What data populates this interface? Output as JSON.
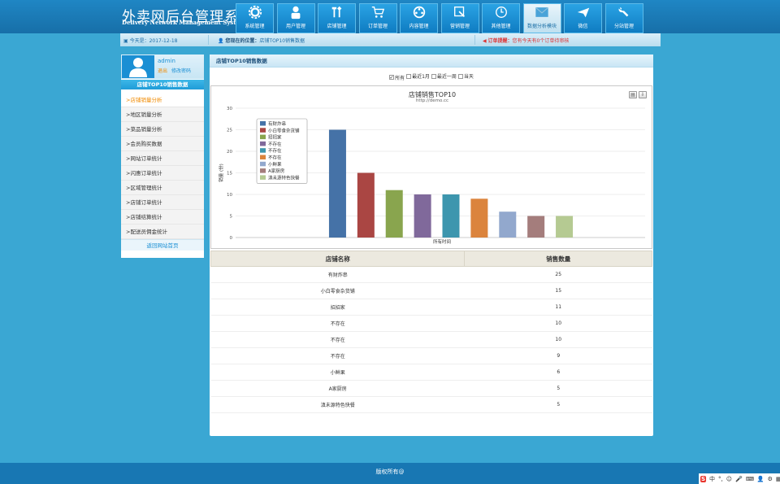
{
  "header": {
    "title": "外卖网后台管理系统",
    "subtitle": "Delivery Network Management System",
    "nav": [
      {
        "label": "系统管理",
        "icon": "gear-icon"
      },
      {
        "label": "用户管理",
        "icon": "user-icon"
      },
      {
        "label": "店铺管理",
        "icon": "tools-icon"
      },
      {
        "label": "订单管理",
        "icon": "cart-icon"
      },
      {
        "label": "内容管理",
        "icon": "film-icon"
      },
      {
        "label": "营销管理",
        "icon": "marketing-icon"
      },
      {
        "label": "其他管理",
        "icon": "clock-icon"
      },
      {
        "label": "数据分析模块",
        "icon": "mail-icon",
        "active": true
      },
      {
        "label": "微信",
        "icon": "plane-icon"
      },
      {
        "label": "分站管理",
        "icon": "wrench-icon"
      }
    ]
  },
  "statusbar": {
    "date": "今天是：2017-12-18",
    "location_label": "您现在的位置：",
    "location_value": "店铺TOP10销售数据",
    "order_label": "订单提醒：",
    "order_value": "您有今天有0个订单待审核"
  },
  "sidebar": {
    "username": "admin",
    "logout": "退出",
    "change_pwd": "修改密码",
    "section_title": "店铺TOP10销售数据",
    "items": [
      {
        "label": ">店铺销量分析",
        "active": true
      },
      {
        "label": ">地区销量分析"
      },
      {
        "label": ">菜品销量分析"
      },
      {
        "label": ">会员购买数据"
      },
      {
        "label": ">网站订单统计"
      },
      {
        "label": ">闪惠订单统计"
      },
      {
        "label": ">区域管理统计"
      },
      {
        "label": ">店铺订单统计"
      },
      {
        "label": ">店铺结算统计"
      },
      {
        "label": ">配送员佣金统计"
      }
    ],
    "back_home": "返回网站首页"
  },
  "main": {
    "title": "店铺TOP10销售数据",
    "filters": [
      {
        "label": "所有",
        "checked": true
      },
      {
        "label": "最近1月",
        "checked": false
      },
      {
        "label": "最近一周",
        "checked": false
      },
      {
        "label": "当天",
        "checked": false
      }
    ],
    "table_headers": [
      "店铺名称",
      "销售数量"
    ]
  },
  "chart_data": {
    "type": "bar",
    "title": "店铺销售TOP10",
    "subtitle": "http://demo.cc",
    "xlabel": "所有时间",
    "ylabel": "销量 (份)",
    "ylim": [
      0,
      30
    ],
    "yticks": [
      0,
      5,
      10,
      15,
      20,
      25,
      30
    ],
    "legend_position": "top-left",
    "grid": true,
    "series": [
      {
        "name": "有财炸串",
        "value": 25,
        "color": "#4572a7"
      },
      {
        "name": "小白零食杂货铺",
        "value": 15,
        "color": "#aa4643"
      },
      {
        "name": "招招家",
        "value": 11,
        "color": "#89a54e"
      },
      {
        "name": "不存在",
        "value": 10,
        "color": "#80699b"
      },
      {
        "name": "不存在",
        "value": 10,
        "color": "#3d96ae"
      },
      {
        "name": "不存在",
        "value": 9,
        "color": "#db843d"
      },
      {
        "name": "小鲜果",
        "value": 6,
        "color": "#92a8cd"
      },
      {
        "name": "A家厨房",
        "value": 5,
        "color": "#a47d7c"
      },
      {
        "name": "滇未源特色快餐",
        "value": 5,
        "color": "#b5ca92"
      }
    ]
  },
  "footer": {
    "copyright": "版权所有@",
    "tray": [
      "S",
      "中",
      "°,",
      "☺",
      "🎤",
      "⌨",
      "👤",
      "⚙",
      "▦"
    ]
  }
}
